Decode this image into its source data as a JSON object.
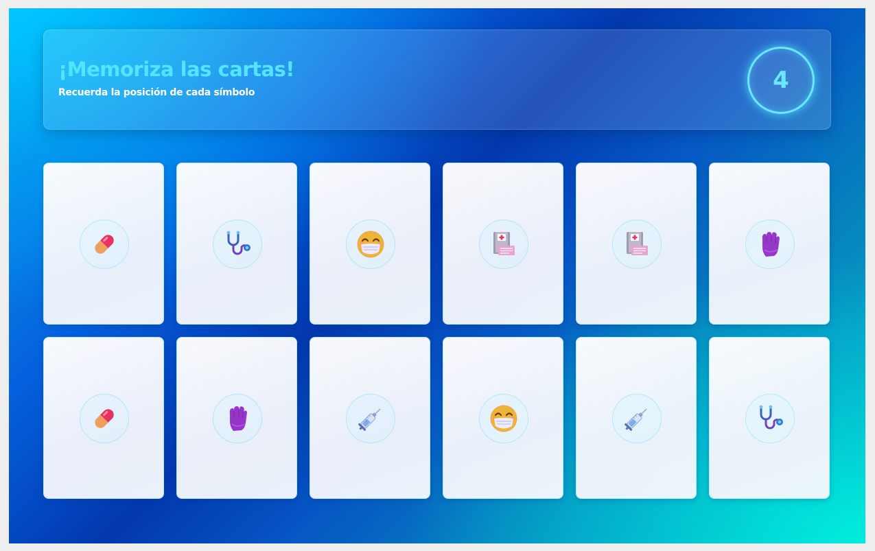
{
  "header": {
    "title": "¡Memoriza las cartas!",
    "subtitle": "Recuerda la posición de cada símbolo",
    "countdown": "4"
  },
  "board": {
    "rows": [
      [
        "pill-icon",
        "stethoscope-icon",
        "face-mask-icon",
        "medical-record-icon",
        "medical-record-icon",
        "glove-icon"
      ],
      [
        "pill-icon",
        "glove-icon",
        "syringe-icon",
        "face-mask-icon",
        "syringe-icon",
        "stethoscope-icon"
      ]
    ]
  },
  "colors": {
    "title": "#54e4ff",
    "timer": "#6ae8ff",
    "card": "#f3f6fc"
  }
}
